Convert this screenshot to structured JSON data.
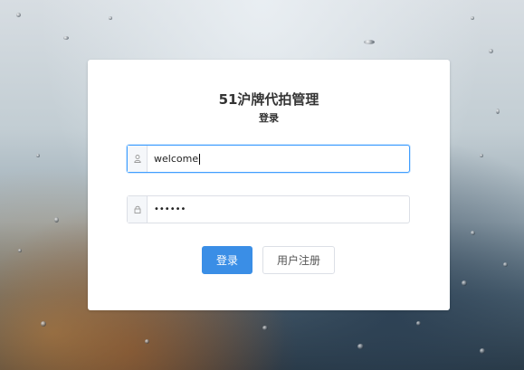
{
  "login_card": {
    "title": "51沪牌代拍管理",
    "subtitle": "登录",
    "username": {
      "value": "welcome",
      "icon": "user-icon"
    },
    "password": {
      "value": "••••••",
      "icon": "lock-icon"
    },
    "buttons": {
      "login_label": "登录",
      "register_label": "用户注册"
    }
  },
  "colors": {
    "primary": "#3a8ee6",
    "focus_border": "#409eff",
    "border": "#dcdfe6"
  }
}
